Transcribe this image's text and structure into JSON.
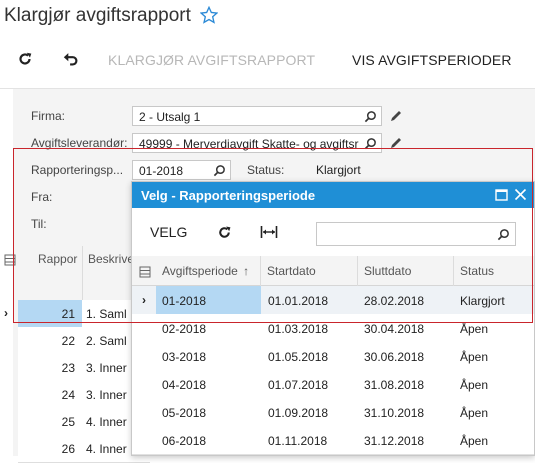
{
  "page": {
    "title": "Klargjør avgiftsrapport"
  },
  "toolbar": {
    "prepare_label": "KLARGJØR AVGIFTSRAPPORT",
    "show_periods_label": "VIS AVGIFTSPERIODER"
  },
  "form": {
    "firma_label": "Firma:",
    "firma_value": "2 - Utsalg 1",
    "leverandor_label": "Avgiftsleverandør:",
    "leverandor_value": "49999 - Merverdiavgift Skatte- og avgiftsr",
    "periode_label": "Rapporteringsp...",
    "periode_value": "01-2018",
    "status_label": "Status:",
    "status_value": "Klargjort",
    "fra_label": "Fra:",
    "til_label": "Til:"
  },
  "left_grid": {
    "headers": {
      "rapport": "Rappor",
      "beskrivelse": "Beskrive"
    },
    "rows": [
      {
        "num": "21",
        "desc": "1. Saml"
      },
      {
        "num": "22",
        "desc": "2. Saml"
      },
      {
        "num": "23",
        "desc": "3. Inner"
      },
      {
        "num": "24",
        "desc": "3. Inner"
      },
      {
        "num": "25",
        "desc": "4. Inner"
      },
      {
        "num": "26",
        "desc": "4. Inner"
      }
    ]
  },
  "dialog": {
    "title": "Velg - Rapporteringsperiode",
    "select_label": "VELG",
    "search_placeholder": "",
    "columns": {
      "period": "Avgiftsperiode",
      "start": "Startdato",
      "end": "Sluttdato",
      "status": "Status"
    },
    "sort_indicator": "↑",
    "rows": [
      {
        "period": "01-2018",
        "start": "01.01.2018",
        "end": "28.02.2018",
        "status": "Klargjort"
      },
      {
        "period": "02-2018",
        "start": "01.03.2018",
        "end": "30.04.2018",
        "status": "Åpen"
      },
      {
        "period": "03-2018",
        "start": "01.05.2018",
        "end": "30.06.2018",
        "status": "Åpen"
      },
      {
        "period": "04-2018",
        "start": "01.07.2018",
        "end": "31.08.2018",
        "status": "Åpen"
      },
      {
        "period": "05-2018",
        "start": "01.09.2018",
        "end": "31.10.2018",
        "status": "Åpen"
      },
      {
        "period": "06-2018",
        "start": "01.11.2018",
        "end": "31.12.2018",
        "status": "Åpen"
      }
    ]
  },
  "colors": {
    "accent": "#1f8fd6",
    "highlight": "#c9252c",
    "selected": "#b4d8f3"
  }
}
